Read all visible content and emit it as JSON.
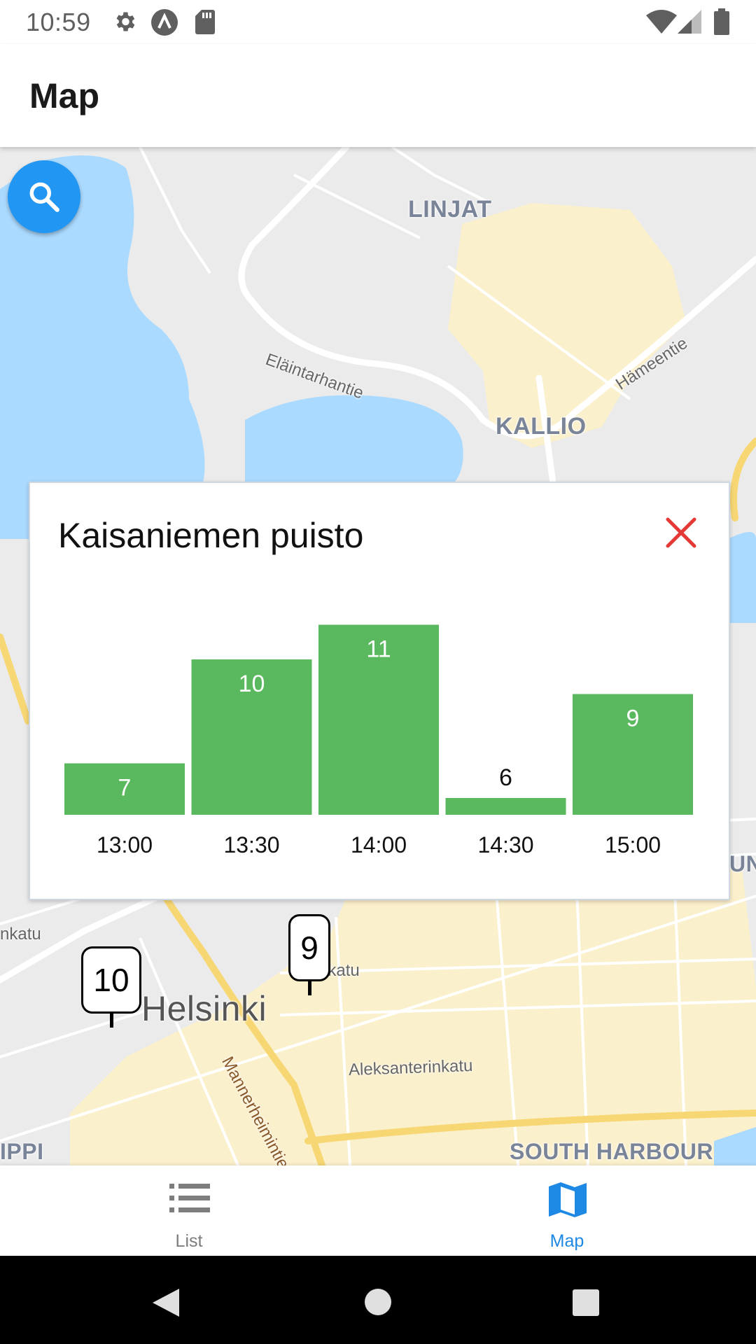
{
  "status_bar": {
    "time": "10:59"
  },
  "app_bar": {
    "title": "Map"
  },
  "map": {
    "place_labels": [
      "LINJAT",
      "KALLIO",
      "Helsinki",
      "SOUTH HARBOUR",
      "IPPI",
      "UN"
    ],
    "street_labels": [
      "Eläintarhantie",
      "Hämeentie",
      "Aleksanterinkatu",
      "Mannerheimintie",
      "nkatu",
      "okatu"
    ],
    "markers": [
      "10",
      "9"
    ]
  },
  "popup": {
    "title": "Kaisaniemen puisto",
    "close_color": "#e53935"
  },
  "chart_data": {
    "type": "bar",
    "categories": [
      "13:00",
      "13:30",
      "14:00",
      "14:30",
      "15:00"
    ],
    "values": [
      7,
      10,
      11,
      6,
      9
    ],
    "title": "",
    "xlabel": "",
    "ylabel": "",
    "bar_color": "#5ab95e"
  },
  "bottom_nav": {
    "items": [
      {
        "label": "List",
        "icon": "list-icon",
        "active": false
      },
      {
        "label": "Map",
        "icon": "map-icon",
        "active": true
      }
    ],
    "active_color": "#1e88e5",
    "inactive_color": "#7d7d7d"
  }
}
